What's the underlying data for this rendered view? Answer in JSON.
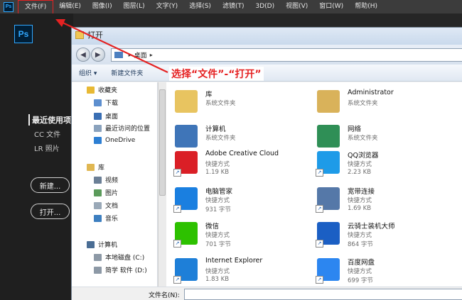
{
  "menubar": {
    "items": [
      "文件(F)",
      "编辑(E)",
      "图像(I)",
      "图层(L)",
      "文字(Y)",
      "选择(S)",
      "滤镜(T)",
      "3D(D)",
      "视图(V)",
      "窗口(W)",
      "帮助(H)"
    ],
    "app_icon": "Ps"
  },
  "home": {
    "logo": "Ps",
    "recent_title": "最近使用项",
    "recent_items": [
      "CC 文件",
      "LR 照片"
    ],
    "new_button": "新建...",
    "open_button": "打开..."
  },
  "dialog": {
    "title": "打开",
    "address": "桌面",
    "toolbar": {
      "organize": "组织 ▾",
      "new_folder": "新建文件夹"
    },
    "nav": [
      {
        "label": "收藏夹",
        "icon": "star-icon",
        "color": "#e8b934"
      },
      {
        "label": "下载",
        "icon": "download-folder-icon",
        "color": "#5d8fcf"
      },
      {
        "label": "桌面",
        "icon": "desktop-icon",
        "color": "#3a6fb4"
      },
      {
        "label": "最近访问的位置",
        "icon": "recent-places-icon",
        "color": "#8aa2bd"
      },
      {
        "label": "OneDrive",
        "icon": "cloud-icon",
        "color": "#2d7fd3"
      },
      {
        "label": "库",
        "icon": "library-icon",
        "color": "#e0b752"
      },
      {
        "label": "视频",
        "icon": "video-icon",
        "color": "#6b7f96"
      },
      {
        "label": "图片",
        "icon": "picture-icon",
        "color": "#5b9b5b"
      },
      {
        "label": "文档",
        "icon": "document-icon",
        "color": "#9aa9b8"
      },
      {
        "label": "音乐",
        "icon": "music-icon",
        "color": "#3d7fc0"
      },
      {
        "label": "计算机",
        "icon": "computer-icon",
        "color": "#4a6d94"
      },
      {
        "label": "本地磁盘 (C:)",
        "icon": "drive-icon",
        "color": "#8d99a6"
      },
      {
        "label": "简学 软件 (D:)",
        "icon": "drive-icon",
        "color": "#8d99a6"
      }
    ],
    "files": [
      {
        "name": "库",
        "line1": "系统文件夹",
        "line2": "",
        "icon": "library-folder-icon",
        "color": "#e8c460"
      },
      {
        "name": "Administrator",
        "line1": "系统文件夹",
        "line2": "",
        "icon": "user-folder-icon",
        "color": "#d9b25a"
      },
      {
        "name": "计算机",
        "line1": "系统文件夹",
        "line2": "",
        "icon": "computer-icon",
        "color": "#3f75b8"
      },
      {
        "name": "网络",
        "line1": "系统文件夹",
        "line2": "",
        "icon": "network-icon",
        "color": "#2f8f56"
      },
      {
        "name": "Adobe Creative Cloud",
        "line1": "快捷方式",
        "line2": "1.19 KB",
        "icon": "creative-cloud-icon",
        "color": "#da1f26"
      },
      {
        "name": "QQ浏览器",
        "line1": "快捷方式",
        "line2": "2.23 KB",
        "icon": "qq-browser-icon",
        "color": "#1e9be8"
      },
      {
        "name": "电脑管家",
        "line1": "快捷方式",
        "line2": "931 字节",
        "icon": "pc-manager-icon",
        "color": "#1a7fe0"
      },
      {
        "name": "宽带连接",
        "line1": "快捷方式",
        "line2": "1.69 KB",
        "icon": "broadband-icon",
        "color": "#5578a8"
      },
      {
        "name": "微信",
        "line1": "快捷方式",
        "line2": "701 字节",
        "icon": "wechat-icon",
        "color": "#2dc100"
      },
      {
        "name": "云骑士装机大师",
        "line1": "快捷方式",
        "line2": "864 字节",
        "icon": "yunqishi-icon",
        "color": "#1b5fc4"
      },
      {
        "name": "Internet Explorer",
        "line1": "快捷方式",
        "line2": "1.83 KB",
        "icon": "internet-explorer-icon",
        "color": "#1e7fd8"
      },
      {
        "name": "百度网盘",
        "line1": "快捷方式",
        "line2": "699 字节",
        "icon": "baidu-netdisk-icon",
        "color": "#2c86f0"
      }
    ],
    "filename_label": "文件名(N):"
  },
  "annotation": {
    "text": "选择“文件”-“打开”",
    "color": "#e52222"
  }
}
